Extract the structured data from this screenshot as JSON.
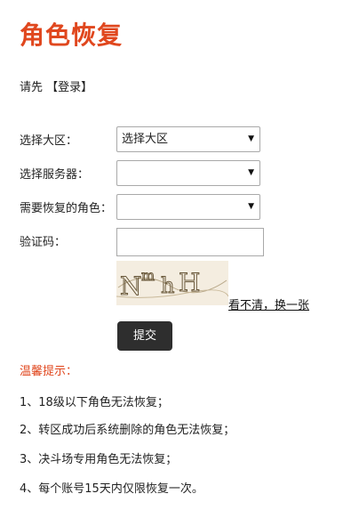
{
  "page": {
    "title": "角色恢复"
  },
  "login": {
    "prefix": "请先",
    "link_label": "【登录】"
  },
  "form": {
    "region_label": "选择大区：",
    "region_value": "选择大区",
    "server_label": "选择服务器：",
    "server_value": "",
    "role_label": "需要恢复的角色：",
    "role_value": "",
    "captcha_label": "验证码：",
    "captcha_value": "",
    "captcha_text": "NmhH",
    "refresh_label": "看不清，换一张",
    "submit_label": "提交"
  },
  "tips": {
    "title": "温馨提示：",
    "items": [
      "1、18级以下角色无法恢复；",
      "2、转区成功后系统删除的角色无法恢复；",
      "3、决斗场专用角色无法恢复；",
      "4、每个账号15天内仅限恢复一次。"
    ]
  },
  "colors": {
    "accent": "#e0471e",
    "button": "#2e2e2e"
  }
}
